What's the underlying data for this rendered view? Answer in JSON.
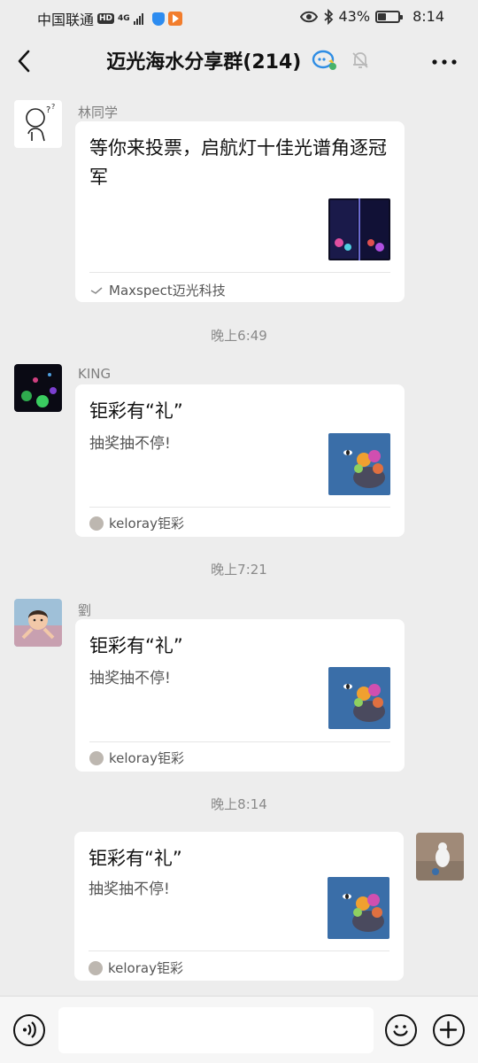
{
  "status_bar": {
    "carrier": "中国联通",
    "hd_badge": "HD",
    "network": "4G",
    "battery_percent": "43%",
    "battery_level": 0.43,
    "time": "8:14"
  },
  "header": {
    "title": "迈光海水分享群(214)"
  },
  "messages": [
    {
      "sender": "林同学",
      "title": "等你来投票，启航灯十佳光谱角逐冠军",
      "source": "Maxspect迈光科技"
    },
    {
      "time": "晚上6:49",
      "sender": "KING",
      "title": "钜彩有“礼”",
      "desc": "抽奖抽不停!",
      "source": "keloray钜彩"
    },
    {
      "time": "晚上7:21",
      "sender": "劉",
      "title": "钜彩有“礼”",
      "desc": "抽奖抽不停!",
      "source": "keloray钜彩"
    },
    {
      "time": "晚上8:14",
      "title": "钜彩有“礼”",
      "desc": "抽奖抽不停!",
      "source": "keloray钜彩"
    }
  ],
  "colors": {
    "background": "#ededed",
    "card": "#ffffff",
    "thumb_blue": "#3a6ea8"
  }
}
